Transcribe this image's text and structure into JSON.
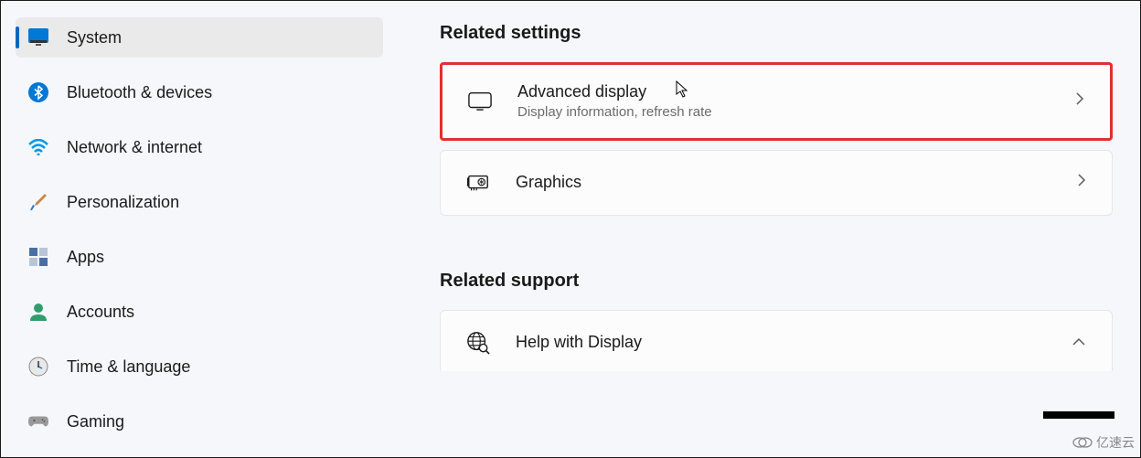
{
  "sidebar": {
    "items": [
      {
        "id": "system",
        "label": "System",
        "active": true
      },
      {
        "id": "bluetooth",
        "label": "Bluetooth & devices",
        "active": false
      },
      {
        "id": "network",
        "label": "Network & internet",
        "active": false
      },
      {
        "id": "personalization",
        "label": "Personalization",
        "active": false
      },
      {
        "id": "apps",
        "label": "Apps",
        "active": false
      },
      {
        "id": "accounts",
        "label": "Accounts",
        "active": false
      },
      {
        "id": "time",
        "label": "Time & language",
        "active": false
      },
      {
        "id": "gaming",
        "label": "Gaming",
        "active": false
      }
    ]
  },
  "main": {
    "related_settings_title": "Related settings",
    "advanced_display": {
      "title": "Advanced display",
      "subtitle": "Display information, refresh rate"
    },
    "graphics": {
      "title": "Graphics"
    },
    "related_support_title": "Related support",
    "help_display": {
      "title": "Help with Display"
    }
  },
  "watermark": "亿速云"
}
